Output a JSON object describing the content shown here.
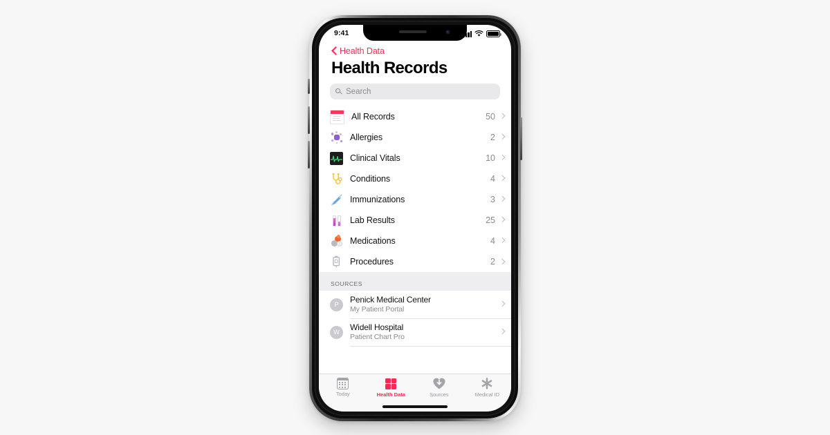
{
  "status_bar": {
    "time": "9:41",
    "cellular_icon": "signal-bars-icon",
    "wifi_icon": "wifi-icon",
    "battery_icon": "battery-icon"
  },
  "nav": {
    "back_label": "Health Data",
    "back_icon": "chevron-left-icon",
    "accent_color": "#FA2A54"
  },
  "header": {
    "title": "Health Records"
  },
  "search": {
    "placeholder": "Search",
    "icon": "search-icon"
  },
  "records": {
    "items": [
      {
        "label": "All Records",
        "count": "50",
        "icon": "document-records-icon",
        "icon_color": "#F03A5C"
      },
      {
        "label": "Allergies",
        "count": "2",
        "icon": "pollen-allergen-icon",
        "icon_color": "#8D60D2"
      },
      {
        "label": "Clinical Vitals",
        "count": "10",
        "icon": "heart-monitor-ekg-icon",
        "icon_color": "#3BD16F"
      },
      {
        "label": "Conditions",
        "count": "4",
        "icon": "stethoscope-icon",
        "icon_color": "#F2C93C"
      },
      {
        "label": "Immunizations",
        "count": "3",
        "icon": "syringe-icon",
        "icon_color": "#5B9BE0"
      },
      {
        "label": "Lab Results",
        "count": "25",
        "icon": "test-tubes-icon",
        "icon_color": "#C457D0"
      },
      {
        "label": "Medications",
        "count": "4",
        "icon": "pills-icon",
        "icon_color": "#F4622F"
      },
      {
        "label": "Procedures",
        "count": "2",
        "icon": "iv-bag-procedure-icon",
        "icon_color": "#A8A8AE"
      }
    ],
    "disclosure_icon": "chevron-right-icon"
  },
  "sources": {
    "header": "SOURCES",
    "items": [
      {
        "initial": "P",
        "name": "Penick Medical Center",
        "subtitle": "My Patient Portal"
      },
      {
        "initial": "W",
        "name": "Widell Hospital",
        "subtitle": "Patient Chart Pro"
      }
    ]
  },
  "tab_bar": {
    "items": [
      {
        "label": "Today",
        "icon": "calendar-today-icon",
        "active": false
      },
      {
        "label": "Health Data",
        "icon": "health-data-grid-icon",
        "active": true
      },
      {
        "label": "Sources",
        "icon": "heart-download-icon",
        "active": false
      },
      {
        "label": "Medical ID",
        "icon": "medical-asterisk-icon",
        "active": false
      }
    ]
  }
}
